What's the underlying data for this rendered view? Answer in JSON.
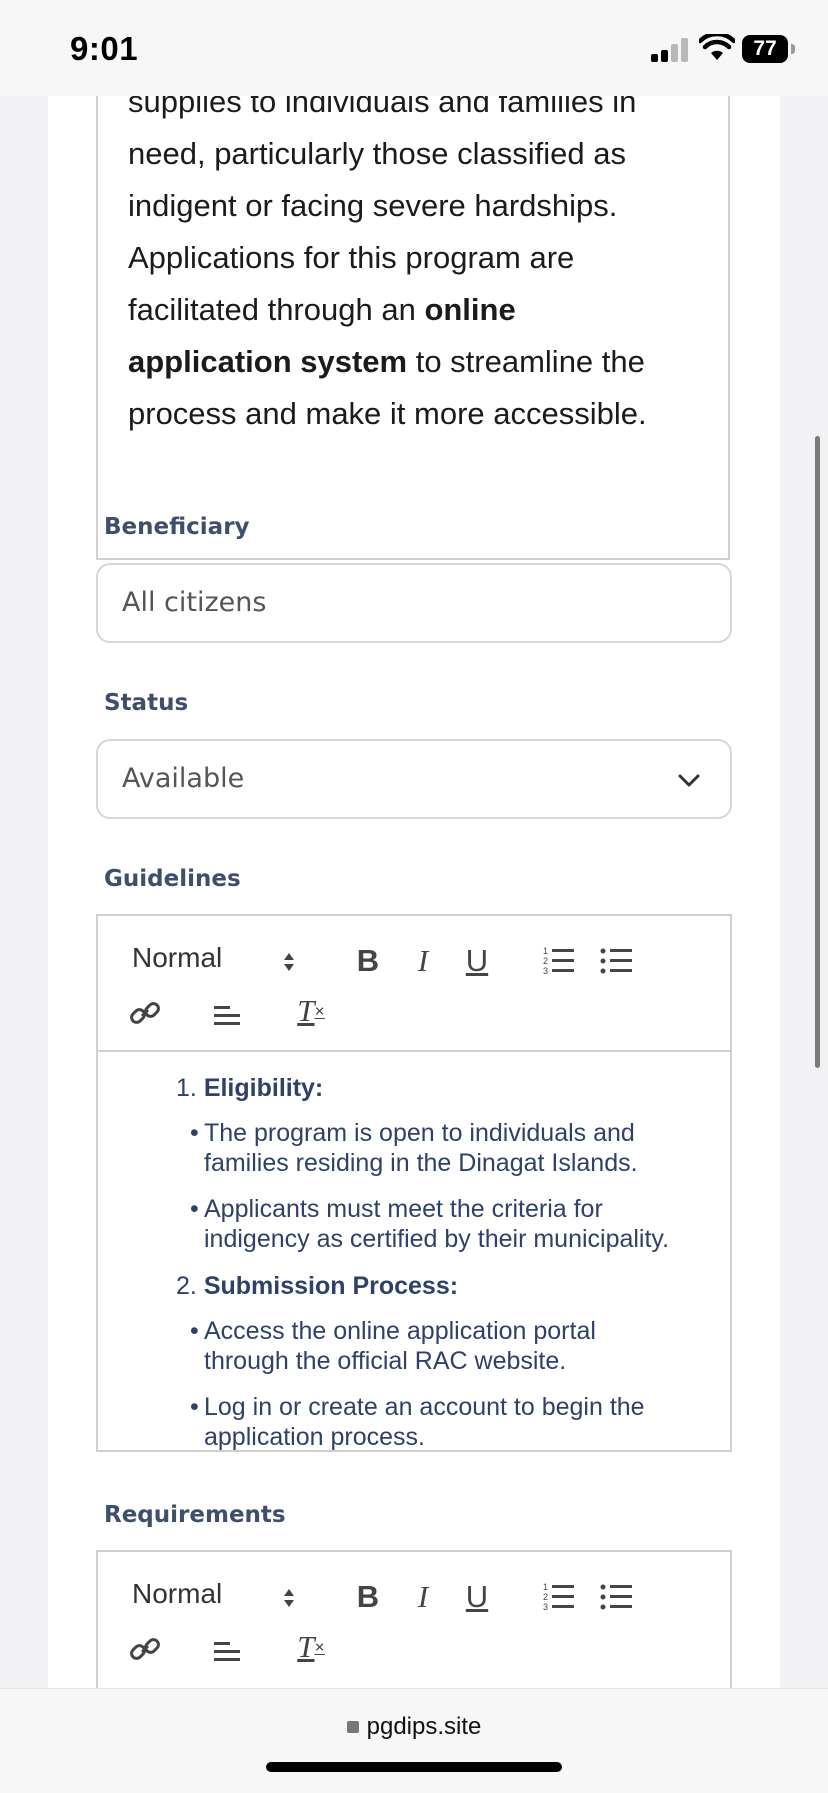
{
  "status_bar": {
    "time": "9:01",
    "battery": "77"
  },
  "intro": {
    "line1": "supplies to individuals and families in",
    "line2": "need, particularly those classified as",
    "line3": "indigent or facing severe hardships.",
    "line4": "Applications for this program are",
    "line5_pre": "facilitated through an ",
    "line5_bold": "online",
    "line6_bold": "application system",
    "line6_post": " to streamline the",
    "line7": "process and make it more accessible."
  },
  "beneficiary": {
    "label": "Beneficiary",
    "value": "All citizens"
  },
  "status": {
    "label": "Status",
    "value": "Available"
  },
  "guidelines": {
    "label": "Guidelines",
    "toolbar": {
      "format": "Normal"
    },
    "items": [
      {
        "num": "1.",
        "title": "Eligibility:"
      },
      {
        "bullet": "The program is open to individuals and",
        "bullet2": "families residing in the Dinagat Islands."
      },
      {
        "bullet": "Applicants must meet the criteria for",
        "bullet2": "indigency as certified by their municipality."
      },
      {
        "num": "2.",
        "title": "Submission Process:"
      },
      {
        "bullet": "Access the online application portal",
        "bullet2": "through the official RAC website."
      },
      {
        "bullet": "Log in or create an account to begin the",
        "bullet2": "application process."
      }
    ]
  },
  "requirements": {
    "label": "Requirements",
    "toolbar": {
      "format": "Normal"
    }
  },
  "browser": {
    "url": "pgdips.site"
  }
}
